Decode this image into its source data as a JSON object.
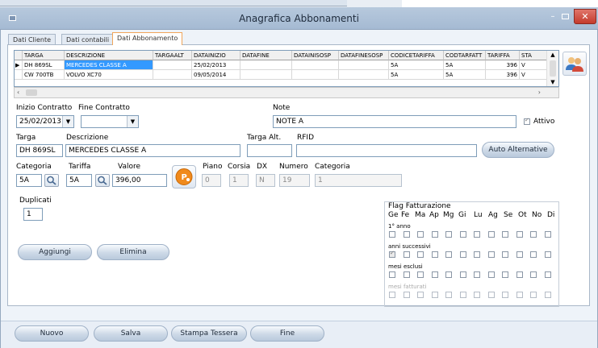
{
  "window": {
    "title": "Anagrafica Abbonamenti",
    "min": "–",
    "close": "✕"
  },
  "tabs": [
    "Dati Cliente",
    "Dati contabili",
    "Dati Abbonamento"
  ],
  "grid": {
    "columns": [
      "TARGA",
      "DESCRIZIONE",
      "TARGAALT",
      "DATAINIZIO",
      "DATAFINE",
      "DATAINISOSP",
      "DATAFINESOSP",
      "CODICETARIFFA",
      "CODTARFATT",
      "TARIFFA",
      "STA"
    ],
    "rows": [
      [
        "DH 869SL",
        "MERCEDES CLASSE A",
        "",
        "25/02/2013",
        "",
        "",
        "",
        "5A",
        "5A",
        "396",
        "V"
      ],
      [
        "CW 700TB",
        "VOLVO XC70",
        "",
        "09/05/2014",
        "",
        "",
        "",
        "5A",
        "5A",
        "396",
        "V"
      ]
    ],
    "row_marker": "▶"
  },
  "form": {
    "inizio_label": "Inizio Contratto",
    "fine_label": "Fine Contratto",
    "note_label": "Note",
    "inizio_value": "25/02/2013",
    "fine_value": "",
    "note_value": "NOTE A",
    "attivo_label": "Attivo",
    "targa_label": "Targa",
    "descrizione_label": "Descrizione",
    "targa_alt_label": "Targa Alt.",
    "rfid_label": "RFID",
    "targa_value": "DH 869SL",
    "descrizione_value": "MERCEDES CLASSE A",
    "targa_alt_value": "",
    "rfid_value": "",
    "auto_alt_label": "Auto Alternative",
    "categoria_label": "Categoria",
    "tariffa_label": "Tariffa",
    "valore_label": "Valore",
    "categoria_value": "5A",
    "tariffa_value": "5A",
    "valore_value": "396,00",
    "piano_label": "Piano",
    "corsia_label": "Corsia",
    "dx_label": "DX",
    "numero_label": "Numero",
    "categoria2_label": "Categoria",
    "piano_value": "0",
    "corsia_value": "1",
    "dx_value": "N",
    "numero_value": "19",
    "categoria2_value": "1",
    "duplicati_label": "Duplicati",
    "duplicati_value": "1",
    "aggiungi_label": "Aggiungi",
    "elimina_label": "Elimina"
  },
  "flags": {
    "title": "Flag Fatturazione",
    "months": [
      "Ge",
      "Fe",
      "Ma",
      "Ap",
      "Mg",
      "Gi",
      "Lu",
      "Ag",
      "Se",
      "Ot",
      "No",
      "Di"
    ],
    "sections": [
      "1° anno",
      "anni successivi",
      "mesi esclusi",
      "mesi fatturati"
    ]
  },
  "bottom": {
    "nuovo": "Nuovo",
    "salva": "Salva",
    "stampa": "Stampa Tessera",
    "fine": "Fine"
  },
  "colors": {
    "titlebar": "#b0c4db",
    "selection": "#3399ff",
    "accent_orange": "#f0a55a"
  },
  "icons": [
    "people-icon",
    "search-icon",
    "parking-icon"
  ]
}
